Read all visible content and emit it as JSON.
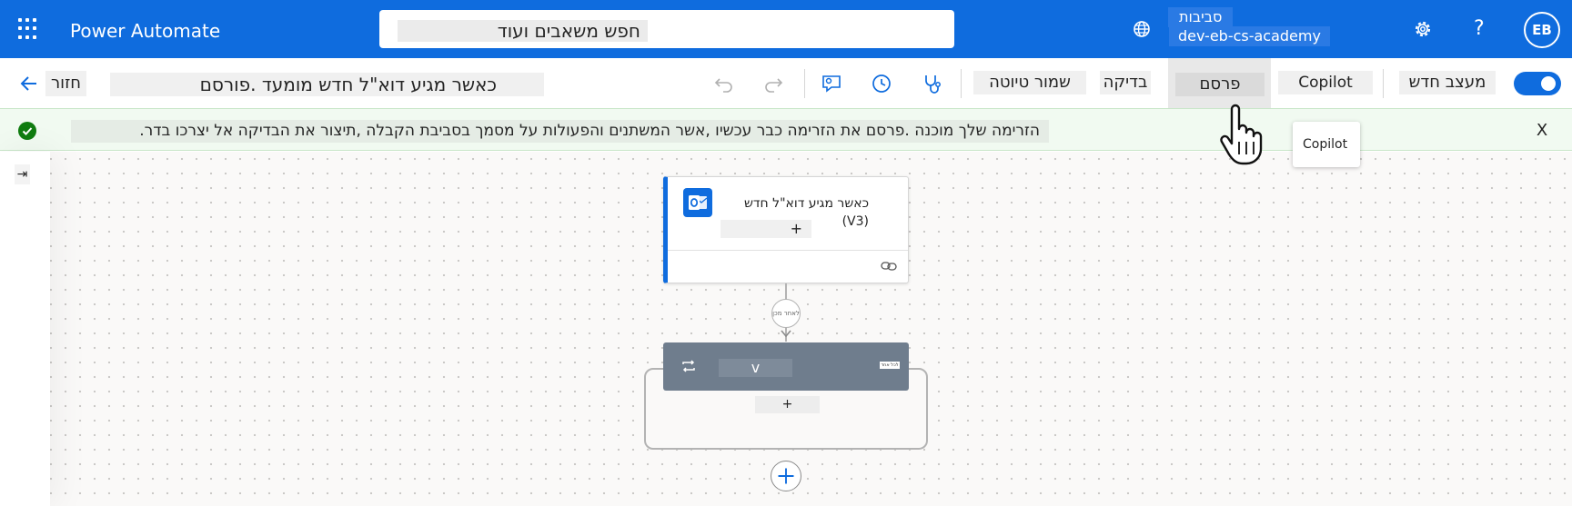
{
  "app": {
    "name": "Power Automate",
    "search_text": "חפש משאבים ועוד",
    "environment_label": "סביבות",
    "environment_name": "dev-eb-cs-academy",
    "avatar_initials": "EB",
    "help_glyph": "?"
  },
  "commandbar": {
    "back_label": "חזור",
    "flow_title": "כאשר מגיע דוא\"ל חדש מומעד .פורסם",
    "save_draft_label": "שמור טיוטה",
    "test_label": "בדיקה",
    "save_label": "פרסם",
    "copilot_label": "Copilot",
    "new_designer_label": "מעצב חדש",
    "new_designer_enabled": true
  },
  "banner": {
    "message": ".הזרימה שלך מוכנה .פרסם את הזרימה כבר עכשיו ,אשר המשתנים והפעולות על מסמך בסביבת הקבלה ,תיצור את הבדיקה אל יצרכו בדר",
    "close_label": "X",
    "status_color": "#107c10"
  },
  "tooltip": {
    "text": "Copilot"
  },
  "canvas": {
    "collapse_glyph": "⇥",
    "trigger_title": "כאשר מגיע דוא\"ל חדש (V3)",
    "trigger_add": "+",
    "condition_label": "לאחר מכן",
    "loop_title": "v",
    "loop_badge": "לכל אחד",
    "loop_add": "+"
  },
  "icons": [
    "waffle-icon",
    "globe-icon",
    "settings-icon",
    "help-icon",
    "back-arrow-icon",
    "undo-icon",
    "redo-icon",
    "feedback-icon",
    "history-icon",
    "flow-checker-icon",
    "check-circle-icon",
    "close-icon",
    "outlook-icon",
    "link-icon",
    "loop-icon",
    "add-icon",
    "hand-cursor-icon"
  ],
  "colors": {
    "brand": "#0f6cde",
    "success": "#107c10",
    "loop_header": "#6f7d8d"
  }
}
